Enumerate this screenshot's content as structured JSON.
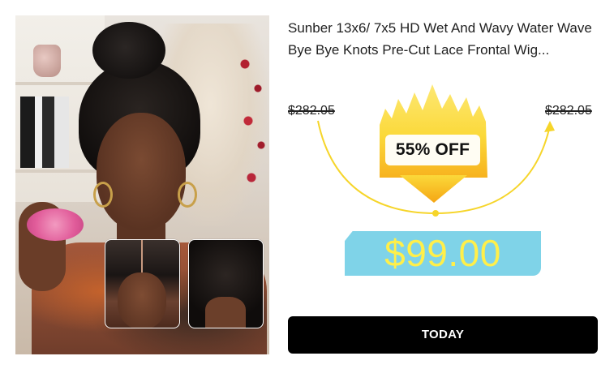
{
  "product": {
    "title": "Sunber 13x6/ 7x5 HD Wet And Wavy Water Wave Bye Bye Knots Pre-Cut Lace Frontal Wig...",
    "original_price_left": "$282.05",
    "original_price_right": "$282.05",
    "discount_label": "55% OFF",
    "sale_price": "$99.00",
    "cta_label": "TODAY"
  },
  "colors": {
    "badge_yellow": "#fbd93a",
    "badge_orange": "#f7b21e",
    "arc_yellow": "#f6d52a",
    "price_box_bg": "#7fd3e8",
    "price_text": "#ffef4a",
    "button_bg": "#000000",
    "button_text": "#ffffff"
  },
  "icons": {
    "flame": "flame-badge-icon",
    "arrow_down": "arrow-down-icon",
    "arrow_up": "arrow-up-icon"
  }
}
